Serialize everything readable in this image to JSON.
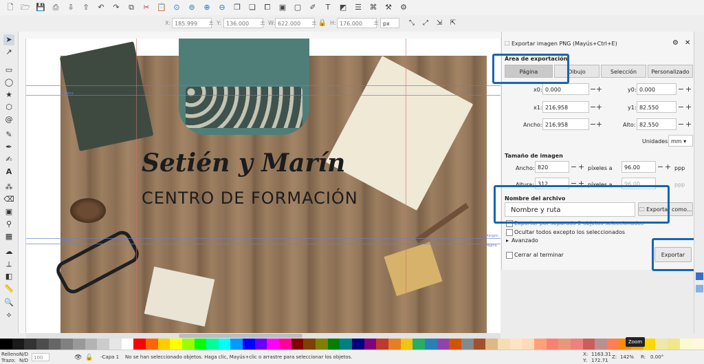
{
  "window": {
    "dialog_title": "Exportar imagen PNG (Mayús+Ctrl+E)"
  },
  "toolbar_icons": [
    "new-icon",
    "open-icon",
    "save-icon",
    "print-icon",
    "import-icon",
    "export-icon",
    "undo-icon",
    "redo-icon",
    "copy-icon",
    "cut-icon",
    "paste-icon",
    "zoom-selection-icon",
    "zoom-drawing-icon",
    "zoom-page-icon",
    "zoom-width-icon",
    "duplicate-icon",
    "clone-icon",
    "unlink-clone-icon",
    "group-icon",
    "ungroup-icon",
    "node-editor-icon",
    "text-icon",
    "fill-stroke-icon",
    "align-icon",
    "xml-editor-icon",
    "preferences-icon",
    "tools-icon"
  ],
  "controlbar": {
    "x_label": "X:",
    "x_value": "185.999",
    "y_label": "Y:",
    "y_value": "136.000",
    "w_label": "W:",
    "w_value": "622.000",
    "h_label": "H:",
    "h_value": "176.000",
    "unit": "px"
  },
  "canvas": {
    "title_script": "Setién y Marín",
    "title_sub": "CENTRO DE FORMACIÓN",
    "guide_labels": {
      "pagina_left": "Página",
      "pagina_right": "Página",
      "margen": "Margen",
      "margen_v": "Margen inicial"
    }
  },
  "export": {
    "area_label": "Área de exportación",
    "area_buttons": [
      "Página",
      "Dibujo",
      "Selección",
      "Personalizado"
    ],
    "selected_area": "Página",
    "x0_label": "x0:",
    "x0": "0.000",
    "y0_label": "y0:",
    "y0": "0.000",
    "x1_label": "x1:",
    "x1": "216.958",
    "y1_label": "y1:",
    "y1": "82.550",
    "width_label": "Ancho:",
    "width": "216.958",
    "height_label": "Alto:",
    "height": "82.550",
    "units_label": "Unidades:",
    "units": "mm",
    "image_size_label": "Tamaño de imagen",
    "img_width_label": "Ancho:",
    "img_width": "820",
    "img_height_label": "Altura:",
    "img_height": "312",
    "pixels_at": "píxeles a",
    "dpi_w": "96.00",
    "dpi_h": "96.00",
    "ppp": "ppp",
    "filename_label": "Nombre del archivo",
    "filename_value": "Nombre y ruta",
    "export_as_button": "Exportar como...",
    "batch_label": "Exportar por separado 2 objetos seleccionados",
    "hide_all_label": "Ocultar todos excepto los seleccionados",
    "advanced_label": "Avanzado",
    "close_on_finish_label": "Cerrar al terminar",
    "export_button": "Exportar"
  },
  "palette": [
    "#000000",
    "#1a1a1a",
    "#333333",
    "#4d4d4d",
    "#666666",
    "#808080",
    "#999999",
    "#b3b3b3",
    "#cccccc",
    "#e6e6e6",
    "#ffffff",
    "#ff0000",
    "#ff6600",
    "#ffcc00",
    "#ffff00",
    "#99ff00",
    "#00ff00",
    "#00ff99",
    "#00ffff",
    "#0099ff",
    "#0000ff",
    "#6600ff",
    "#ff00ff",
    "#ff0099",
    "#800000",
    "#804000",
    "#808000",
    "#008000",
    "#008080",
    "#000080",
    "#800080",
    "#c0392b",
    "#e67e22",
    "#f1c40f",
    "#27ae60",
    "#2980b9",
    "#8e44ad",
    "#d35400",
    "#7f8c8d",
    "#a0522d",
    "#deb887",
    "#f5deb3",
    "#ffe4c4",
    "#ffdab9",
    "#ffa07a",
    "#fa8072",
    "#e9967a",
    "#f08080",
    "#cd5c5c",
    "#bc8f8f",
    "#ff7f50",
    "#ff8c00",
    "#ffa500",
    "#ffd700",
    "#eee8aa",
    "#f0e68c",
    "#fafad2",
    "#fff8dc"
  ],
  "status": {
    "fill_label": "Relleno:",
    "fill_value": "N/D",
    "stroke_label": "Trazo:",
    "stroke_value": "N/D",
    "opacity": "100",
    "layer": "-Capa 1",
    "message": "No se han seleccionado objetos. Haga clic, Mayús+clic o arrastre para seleccionar los objetos.",
    "x_label": "X:",
    "x": "1163.31",
    "y_label": "Y:",
    "y": "172.71",
    "z_label": "Z:",
    "zoom": "142%",
    "r_label": "R:",
    "rotation": "0.00°",
    "zoom_tooltip": "Zoom"
  }
}
